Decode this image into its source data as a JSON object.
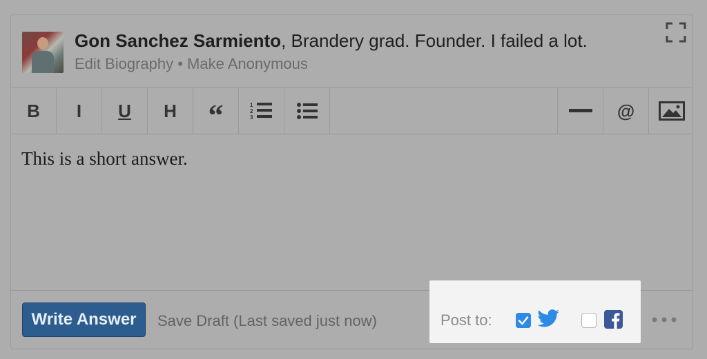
{
  "header": {
    "author_name": "Gon Sanchez Sarmiento",
    "author_bio": ", Brandery grad. Founder. I failed a lot.",
    "edit_biography": "Edit Biography",
    "separator": " • ",
    "make_anonymous": "Make Anonymous"
  },
  "toolbar": {
    "bold": "B",
    "italic": "I",
    "underline": "U",
    "heading": "H",
    "quote": "“",
    "at": "@"
  },
  "editor": {
    "content": "This is a short answer."
  },
  "footer": {
    "write_answer": "Write Answer",
    "save_draft": "Save Draft (Last saved just now)",
    "post_to": "Post to:",
    "twitter_checked": true,
    "facebook_checked": false
  },
  "colors": {
    "primary_button": "#2d5d8f",
    "checkbox_on": "#2d8ae5",
    "twitter": "#2d8ae5",
    "facebook": "#3b5998"
  }
}
